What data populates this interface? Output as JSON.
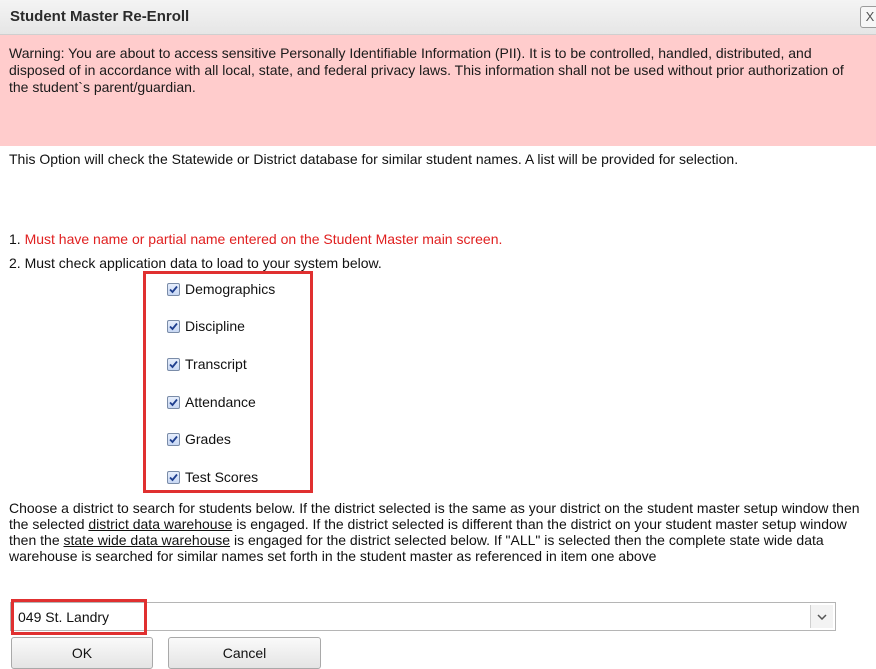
{
  "dialog": {
    "title": "Student Master Re-Enroll",
    "close_label": "X"
  },
  "warning": {
    "text": "Warning: You are about to access sensitive Personally Identifiable Information (PII). It is to be controlled, handled, distributed, and disposed of in accordance with all local, state, and federal privacy laws. This information shall not be used without prior authorization of the student`s parent/guardian."
  },
  "info": {
    "text": "This Option will check the Statewide or District database for similar student names. A list will be provided for selection."
  },
  "steps": {
    "step1_prefix": "1. ",
    "step1_text": "Must have name or partial name entered on the Student Master main screen.",
    "step2_text": "2. Must check application data to load to your system below."
  },
  "checkboxes": [
    {
      "label": "Demographics",
      "checked": true
    },
    {
      "label": "Discipline",
      "checked": true
    },
    {
      "label": "Transcript",
      "checked": true
    },
    {
      "label": "Attendance",
      "checked": true
    },
    {
      "label": "Grades",
      "checked": true
    },
    {
      "label": "Test Scores",
      "checked": true
    }
  ],
  "district_description": {
    "part1": "Choose a district to search for students below. If the district selected is the same as your district on the student master setup window then the selected ",
    "link1": "district data warehouse",
    "part2": " is engaged. If the district selected is different than the district on your student master setup window then the ",
    "link2": "state wide data warehouse",
    "part3": " is engaged for the district selected below. If \"ALL\" is selected then the complete state wide data warehouse is searched for similar names set forth in the student master as referenced in item one above"
  },
  "district_select": {
    "value": "049 St. Landry"
  },
  "buttons": {
    "ok": "OK",
    "cancel": "Cancel"
  },
  "colors": {
    "warning_bg": "#ffcccc",
    "step1_red": "#e02020",
    "highlight_border": "#e03030"
  }
}
